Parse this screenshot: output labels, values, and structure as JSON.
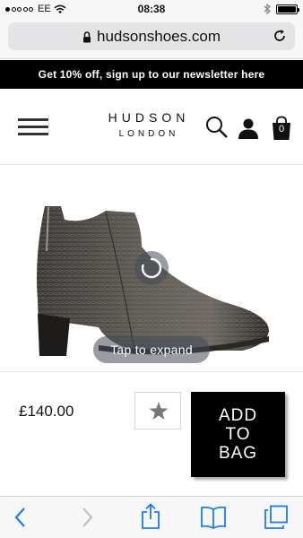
{
  "status_bar": {
    "carrier": "EE",
    "time": "08:38"
  },
  "url_bar": {
    "domain": "hudsonshoes.com"
  },
  "promo": {
    "text": "Get 10% off, sign up to our newsletter here"
  },
  "header": {
    "logo_main": "HUDSON",
    "logo_sub": "LONDON",
    "bag_count": "0"
  },
  "product": {
    "expand_label": "Tap to expand",
    "price": "£140.00",
    "add_to_bag": [
      "ADD",
      "TO",
      "BAG"
    ]
  },
  "colors": {
    "accent": "#000000",
    "link_blue": "#1a7cf5"
  },
  "icons": [
    "wifi-icon",
    "bluetooth-icon",
    "battery-icon",
    "lock-icon",
    "reload-icon",
    "menu-icon",
    "search-icon",
    "account-icon",
    "bag-icon",
    "star-icon",
    "back-icon",
    "forward-icon",
    "share-icon",
    "bookmarks-icon",
    "tabs-icon"
  ]
}
